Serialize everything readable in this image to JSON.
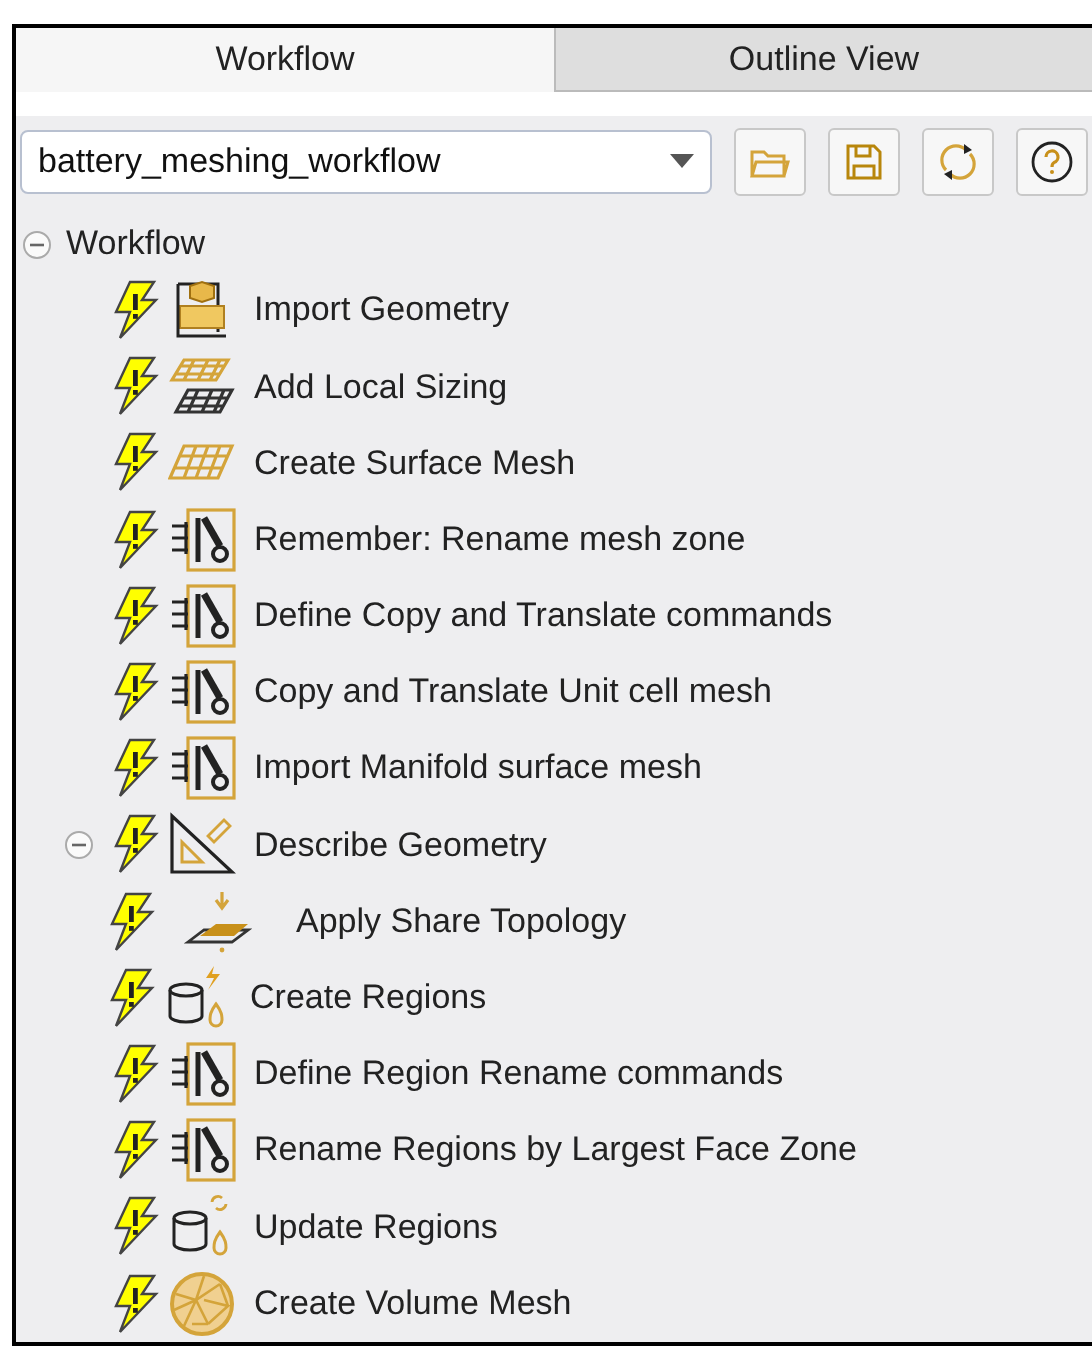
{
  "tabs": [
    {
      "label": "Workflow",
      "selected": true
    },
    {
      "label": "Outline View",
      "selected": false
    }
  ],
  "workflow_select": {
    "value": "battery_meshing_workflow"
  },
  "toolbar": [
    {
      "kind": "open"
    },
    {
      "kind": "save"
    },
    {
      "kind": "refresh"
    },
    {
      "kind": "help"
    }
  ],
  "tree": {
    "label": "Workflow",
    "expanded": true,
    "children": [
      {
        "label": "Import Geometry",
        "kind": "cad"
      },
      {
        "label": "Add Local Sizing",
        "kind": "sizing"
      },
      {
        "label": "Create Surface Mesh",
        "kind": "surface-mesh"
      },
      {
        "label": "Remember: Rename mesh zone",
        "kind": "command"
      },
      {
        "label": "Define Copy and Translate commands",
        "kind": "command"
      },
      {
        "label": "Copy and Translate Unit cell mesh",
        "kind": "command"
      },
      {
        "label": "Import Manifold surface mesh",
        "kind": "command"
      },
      {
        "label": "Describe Geometry",
        "kind": "describe",
        "expanded": true,
        "children": [
          {
            "label": "Apply Share Topology",
            "kind": "share-topology"
          },
          {
            "label": "Create Regions",
            "kind": "create-regions"
          }
        ]
      },
      {
        "label": "Define Region Rename commands",
        "kind": "command"
      },
      {
        "label": "Rename Regions by Largest Face Zone",
        "kind": "command"
      },
      {
        "label": "Update Regions",
        "kind": "update-regions"
      },
      {
        "label": "Create Volume Mesh",
        "kind": "volume-mesh"
      }
    ]
  }
}
